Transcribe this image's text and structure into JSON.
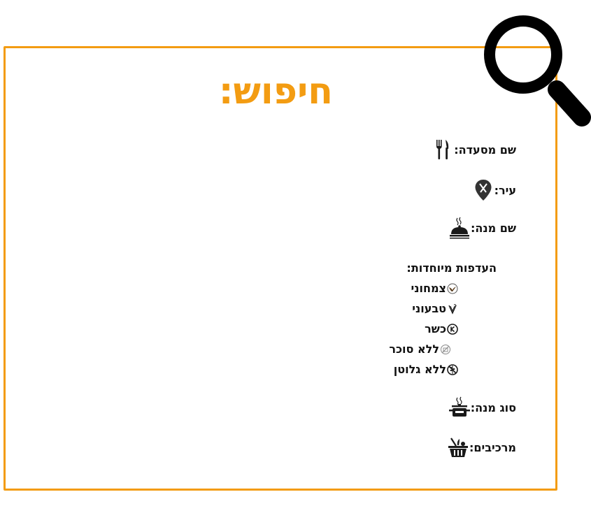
{
  "page": {
    "title": "חיפוש:"
  },
  "fields": {
    "restaurant_name": {
      "label": "שם מסעדה:",
      "icon": "fork-knife-icon"
    },
    "city": {
      "label": "עיר:",
      "icon": "location-pin-icon"
    },
    "dish_name": {
      "label": "שם מנה:",
      "icon": "serving-dish-icon"
    },
    "dish_type": {
      "label": "סוג מנה:",
      "icon": "cooking-pot-icon"
    },
    "ingredients": {
      "label": "מרכיבים:",
      "icon": "basket-icon"
    }
  },
  "preferences": {
    "heading": "העדפות מיוחדות:",
    "items": [
      {
        "label": "צמחוני",
        "icon": "vegetarian-icon"
      },
      {
        "label": "טבעוני",
        "icon": "vegan-icon"
      },
      {
        "label": "כשר",
        "icon": "kosher-icon"
      },
      {
        "label": "ללא סוכר",
        "icon": "no-sugar-icon"
      },
      {
        "label": "ללא גלוטן",
        "icon": "no-gluten-icon"
      }
    ]
  },
  "colors": {
    "accent": "#f39c12",
    "text": "#111111",
    "icon": "#1a1a1a"
  }
}
